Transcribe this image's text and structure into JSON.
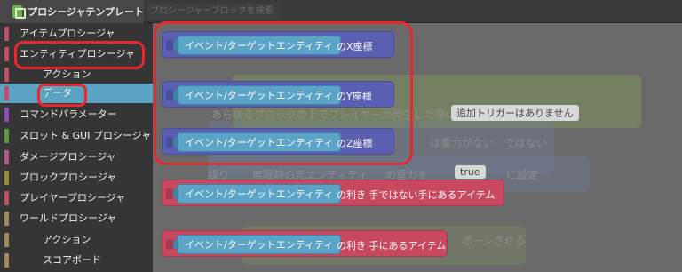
{
  "tab": {
    "title": "プロシージャテンプレート"
  },
  "search": {
    "placeholder": "プロシージャーブロックを検索"
  },
  "sidebar": {
    "items": [
      {
        "label": "アイテムプロシージャ",
        "color": "#c0506a",
        "sub": false
      },
      {
        "label": "エンティティプロシージャ",
        "color": "#c0506a",
        "sub": false
      },
      {
        "label": "アクション",
        "color": "#c0506a",
        "sub": true
      },
      {
        "label": "データ",
        "color": "#c0506a",
        "sub": true
      },
      {
        "label": "コマンドパラメーター",
        "color": "#8a4fb0",
        "sub": false
      },
      {
        "label": "スロット & GUI プロシージャ",
        "color": "#5a9a3c",
        "sub": false
      },
      {
        "label": "ダメージプロシージャ",
        "color": "#b05a8a",
        "sub": false
      },
      {
        "label": "ブロックプロシージャ",
        "color": "#9a8a3c",
        "sub": false
      },
      {
        "label": "プレイヤープロシージャ",
        "color": "#c0506a",
        "sub": false
      },
      {
        "label": "ワールドプロシージャ",
        "color": "#a08a5a",
        "sub": false
      },
      {
        "label": "アクション",
        "color": "#a08a5a",
        "sub": true
      },
      {
        "label": "スコアボード",
        "color": "#a08a5a",
        "sub": true
      }
    ]
  },
  "workspace": {
    "ghosts": {
      "event_line": "あらゆるブロックの上でプレイヤーが発生した際に実行される",
      "trigger_pill": "追加トリガーはありません",
      "gravity_1": "は重力がない",
      "gravity_2": "ではない",
      "set_prefix": "繰り",
      "set_mid": "無限時の元エンティティ",
      "set_gravity": "の重力を",
      "true_pill": "true",
      "set_suffix": "に設定",
      "spawn": "ポーンさせる"
    },
    "blocks": [
      {
        "inner": "イベント/ターゲットエンティティ",
        "suffix": "のX座標",
        "color": "blue"
      },
      {
        "inner": "イベント/ターゲットエンティティ",
        "suffix": "のY座標",
        "color": "blue"
      },
      {
        "inner": "イベント/ターゲットエンティティ",
        "suffix": "のZ座標",
        "color": "blue"
      },
      {
        "inner": "イベント/ターゲットエンティティ",
        "suffix": "の利き 手ではない手にあるアイテム",
        "color": "red"
      },
      {
        "inner": "イベント/ターゲットエンティティ",
        "suffix": "の利き 手にあるアイテム",
        "color": "red"
      }
    ]
  },
  "colors": {
    "highlight": "#e8282e",
    "selected": "#5aa3c2",
    "entity_blue": "#5b5fb2",
    "item_red": "#c84860"
  }
}
